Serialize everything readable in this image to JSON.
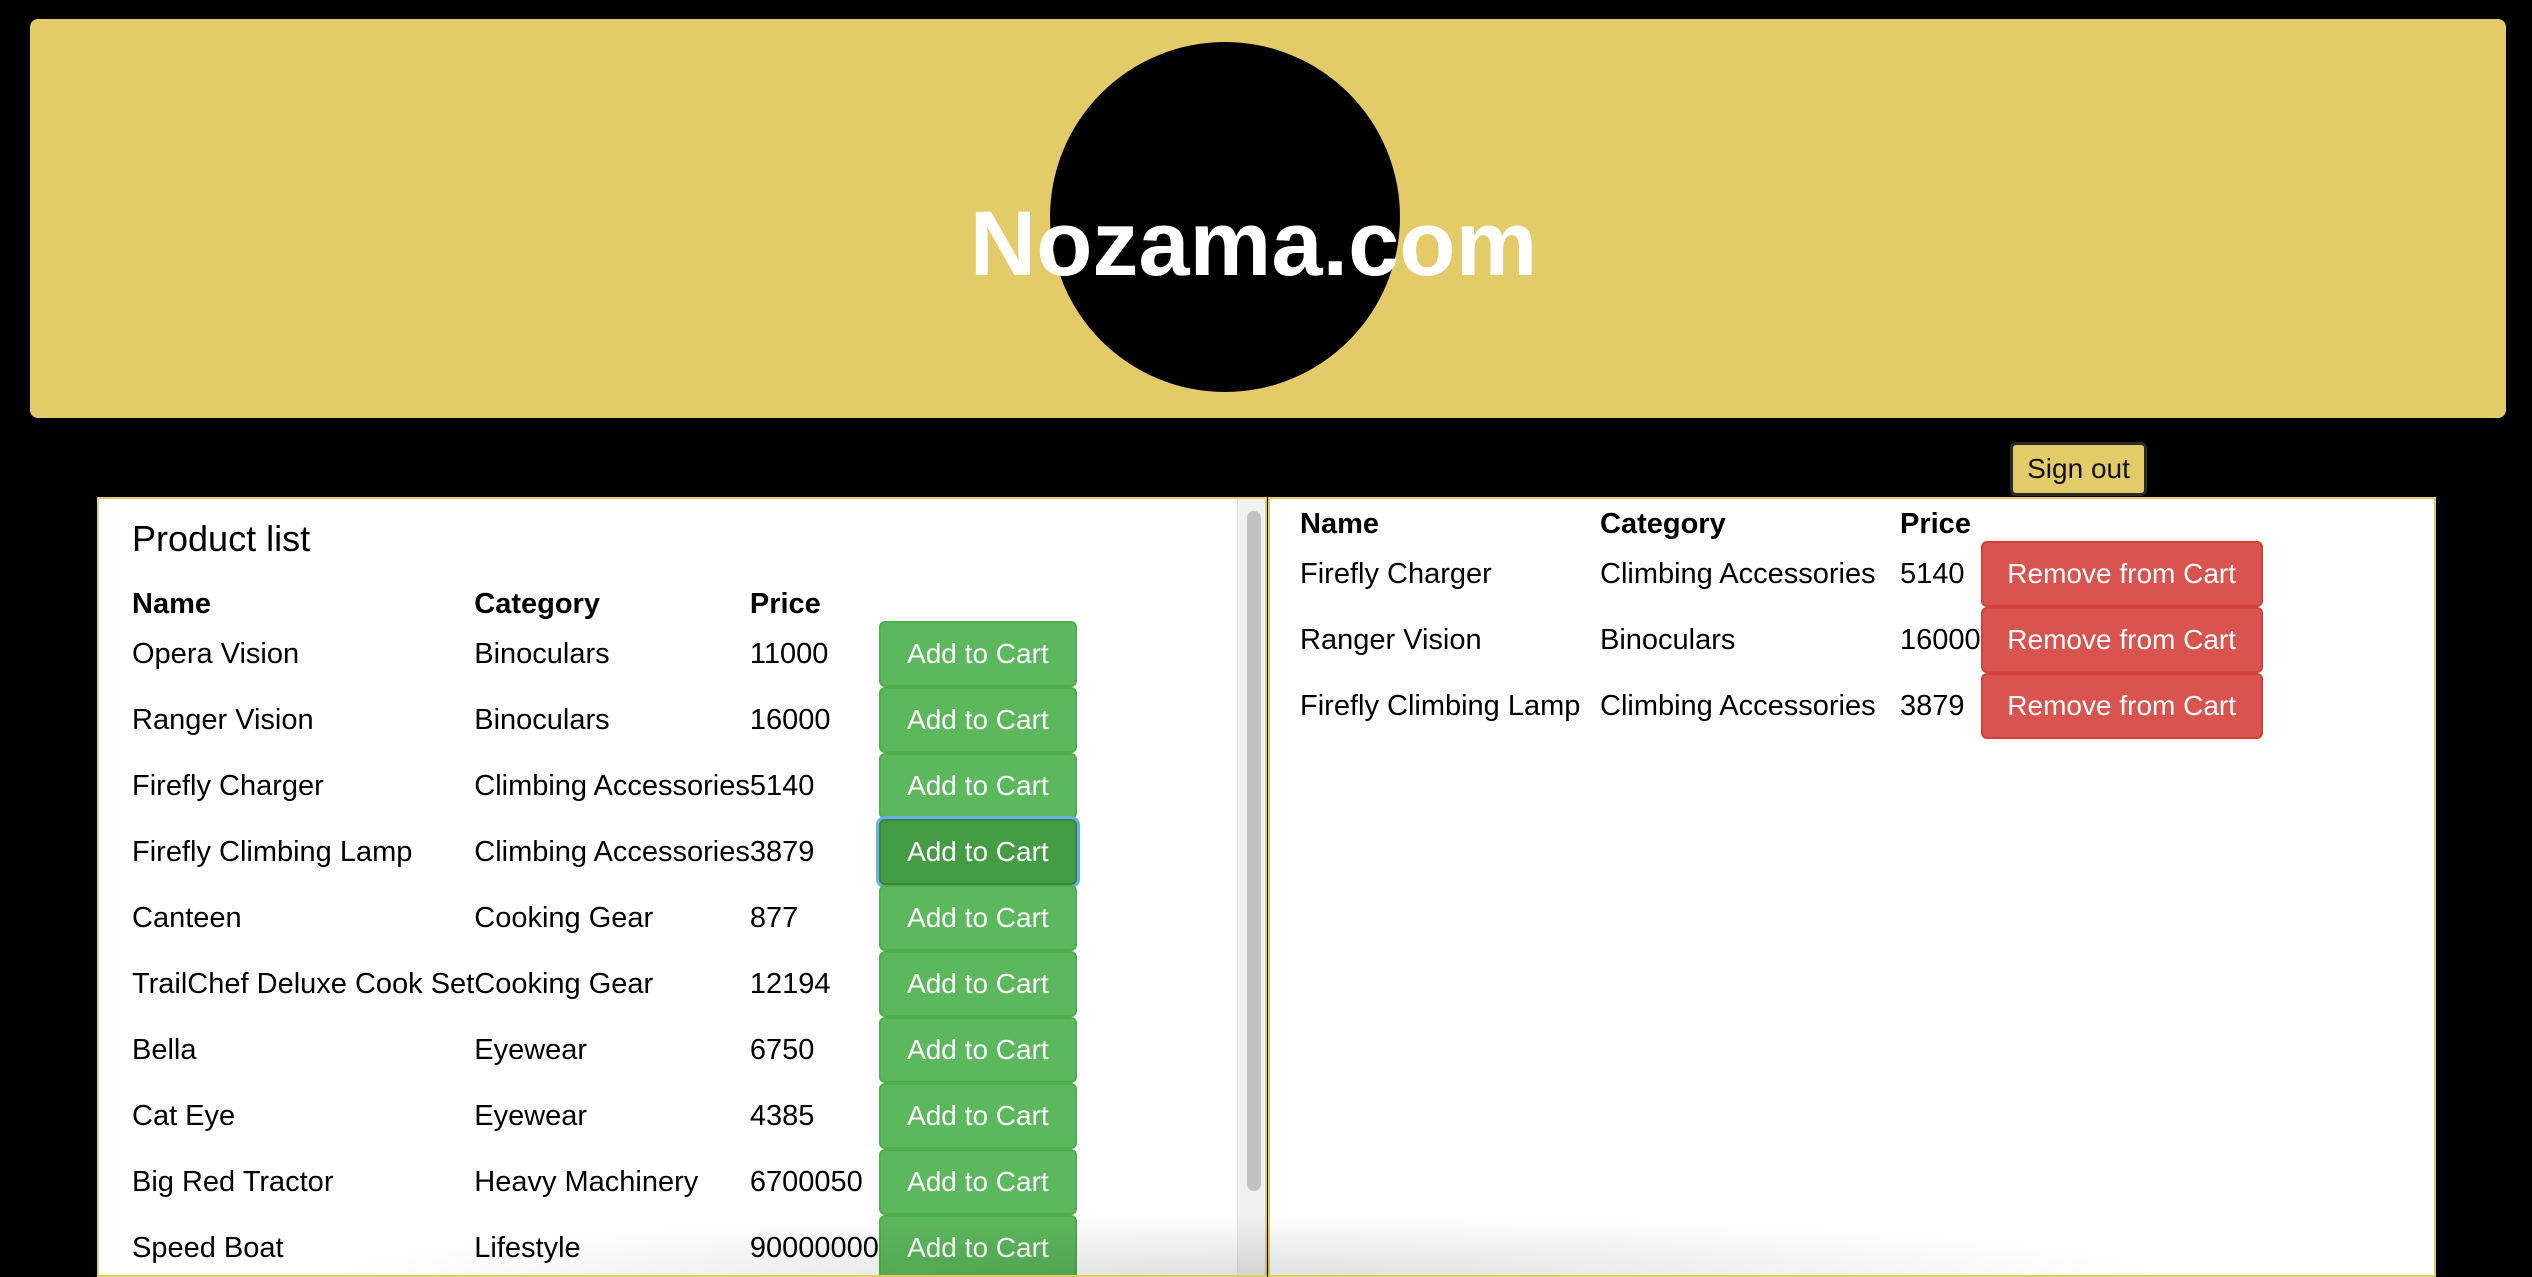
{
  "header": {
    "site_title": "Nozama.com"
  },
  "signout_label": "Sign out",
  "products": {
    "title": "Product list",
    "columns": [
      "Name",
      "Category",
      "Price"
    ],
    "rows": [
      {
        "name": "Opera Vision",
        "category": "Binoculars",
        "price": "11000",
        "action": "Add to Cart"
      },
      {
        "name": "Ranger Vision",
        "category": "Binoculars",
        "price": "16000",
        "action": "Add to Cart"
      },
      {
        "name": "Firefly Charger",
        "category": "Climbing Accessories",
        "price": "5140",
        "action": "Add to Cart"
      },
      {
        "name": "Firefly Climbing Lamp",
        "category": "Climbing Accessories",
        "price": "3879",
        "action": "Add to Cart"
      },
      {
        "name": "Canteen",
        "category": "Cooking Gear",
        "price": "877",
        "action": "Add to Cart"
      },
      {
        "name": "TrailChef Deluxe Cook Set",
        "category": "Cooking Gear",
        "price": "12194",
        "action": "Add to Cart"
      },
      {
        "name": "Bella",
        "category": "Eyewear",
        "price": "6750",
        "action": "Add to Cart"
      },
      {
        "name": "Cat Eye",
        "category": "Eyewear",
        "price": "4385",
        "action": "Add to Cart"
      },
      {
        "name": "Big Red Tractor",
        "category": "Heavy Machinery",
        "price": "6700050",
        "action": "Add to Cart"
      },
      {
        "name": "Speed Boat",
        "category": "Lifestyle",
        "price": "90000000",
        "action": "Add to Cart"
      }
    ]
  },
  "cart": {
    "columns": [
      "Name",
      "Category",
      "Price"
    ],
    "rows": [
      {
        "name": "Firefly Charger",
        "category": "Climbing Accessories",
        "price": "5140",
        "action": "Remove from Cart"
      },
      {
        "name": "Ranger Vision",
        "category": "Binoculars",
        "price": "16000",
        "action": "Remove from Cart"
      },
      {
        "name": "Firefly Climbing Lamp",
        "category": "Climbing Accessories",
        "price": "3879",
        "action": "Remove from Cart"
      }
    ]
  },
  "colors": {
    "banner": "#e4cb6a",
    "add_button": "#5cb85c",
    "remove_button": "#d9534f",
    "background": "#000000"
  }
}
